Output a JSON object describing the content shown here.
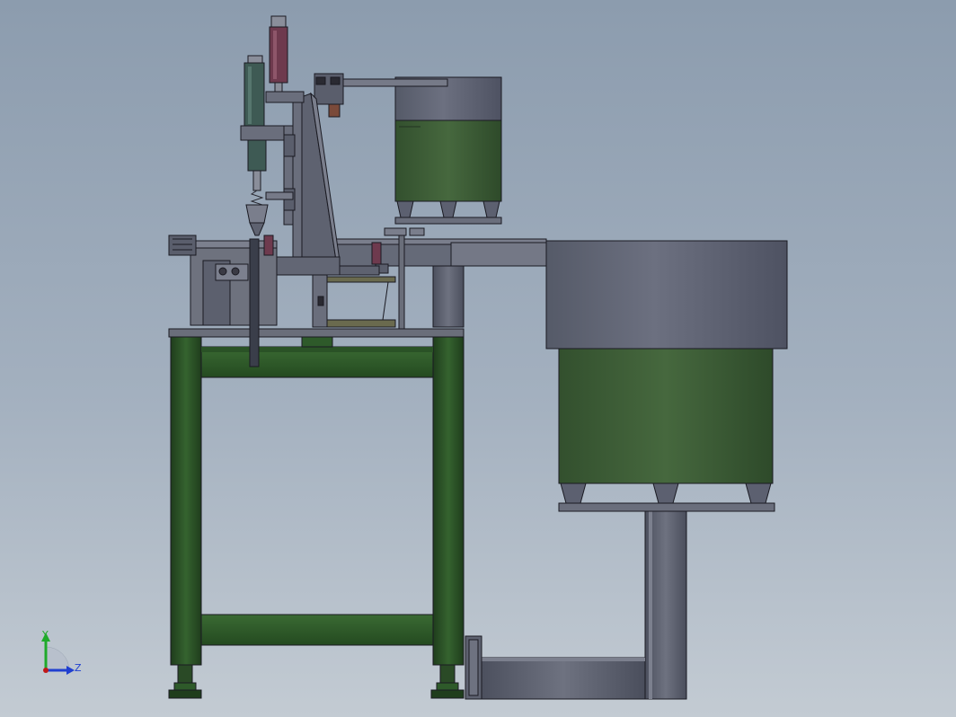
{
  "triad": {
    "y_label": "Y",
    "z_label": "Z",
    "y_color": "#1faa2a",
    "z_color": "#1f3fd0",
    "origin_color": "#c01818"
  },
  "colors": {
    "background_top": "#8c9cae",
    "background_bottom": "#c3cbd3",
    "frame_green": "#2e5a2a",
    "frame_green_dark": "#1e3e1c",
    "steel_grey": "#5a5e6c",
    "steel_light": "#7c808e",
    "bowl_green": "#3c5a36",
    "cylinder_purple": "#6e3a4e",
    "cylinder_teal": "#3e5a54",
    "outline": "#1a1a22"
  }
}
